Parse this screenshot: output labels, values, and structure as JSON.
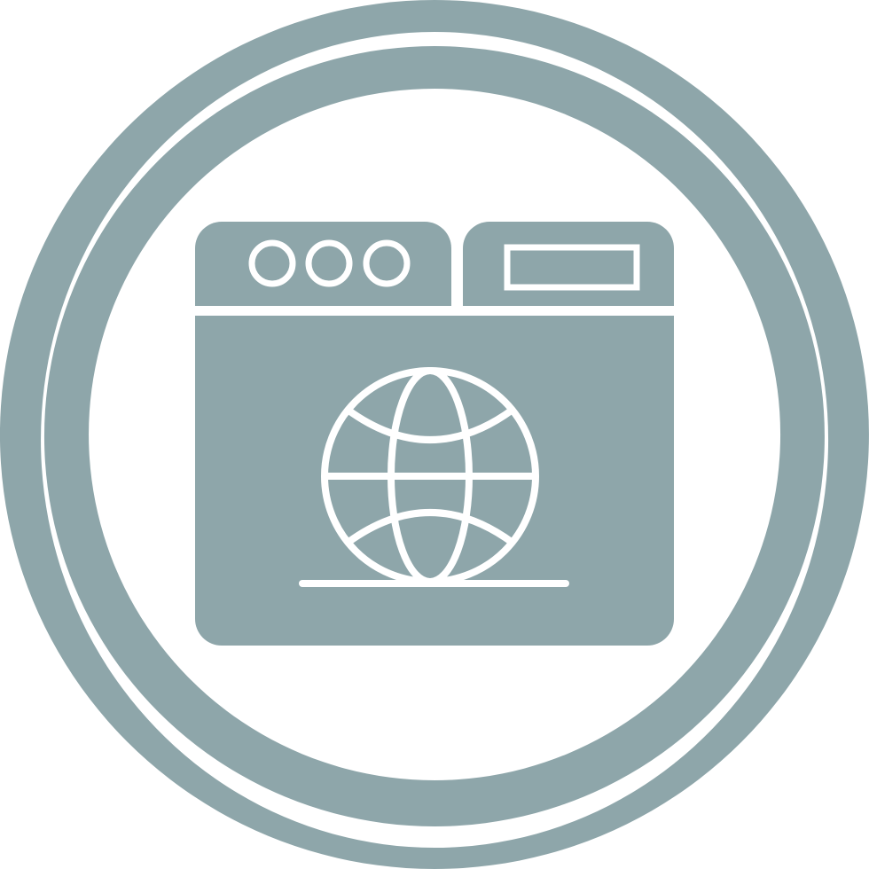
{
  "icon": {
    "name": "web-browser-globe-icon",
    "colors": {
      "primary": "#8ea6aa",
      "background": "#ffffff",
      "detail": "#ffffff"
    },
    "parts": [
      "outer-ring",
      "browser-window",
      "window-control-dots",
      "address-bar",
      "globe",
      "globe-base-line"
    ]
  }
}
